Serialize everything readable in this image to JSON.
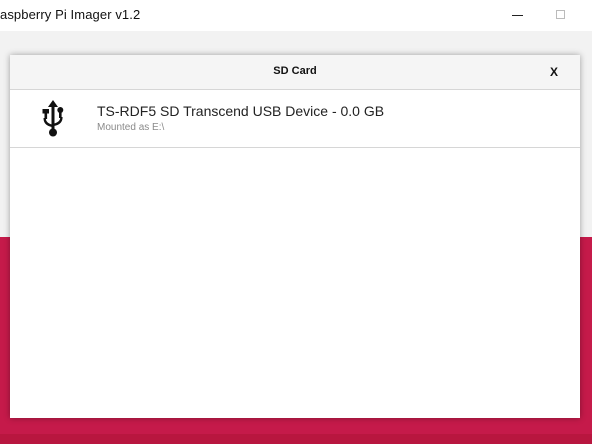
{
  "window": {
    "title": "aspberry Pi Imager v1.2"
  },
  "dialog": {
    "title": "SD Card",
    "close_label": "X"
  },
  "devices": [
    {
      "name": "TS-RDF5 SD Transcend USB Device - 0.0 GB",
      "mount": "Mounted as E:\\",
      "icon": "usb-icon"
    }
  ],
  "colors": {
    "brand": "#c51a4a",
    "app_background": "#f2f2f2",
    "dialog_header": "#f5f5f5"
  }
}
